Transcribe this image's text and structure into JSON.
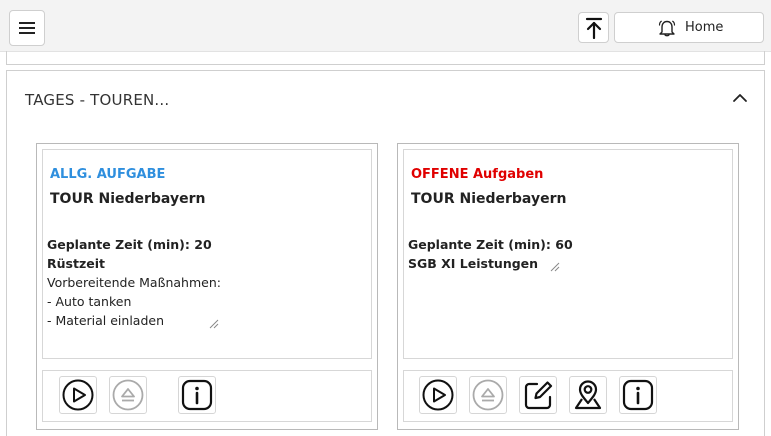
{
  "header": {
    "menu_icon": "hamburger-icon",
    "top_icon": "arrow-to-top-icon",
    "home_label": "Home",
    "home_icon": "bell-icon"
  },
  "section": {
    "title": "TAGES - TOUREN...",
    "toggle_icon": "chevron-up-icon"
  },
  "cards": [
    {
      "category": "ALLG. AUFGABE",
      "category_color": "#2f8fde",
      "tour": "TOUR Niederbayern",
      "planned_time": "Geplante Zeit (min): 20",
      "type": "Rüstzeit",
      "notes": [
        "Vorbereitende Maßnahmen:",
        "- Auto tanken",
        "- Material einladen"
      ],
      "actions": [
        "play-icon",
        "eject-icon",
        "info-icon"
      ]
    },
    {
      "category": "OFFENE Aufgaben",
      "category_color": "#e00000",
      "tour": "TOUR Niederbayern",
      "planned_time": "Geplante Zeit (min): 60",
      "type": "SGB XI Leistungen",
      "notes": [],
      "actions": [
        "play-icon",
        "eject-icon",
        "edit-icon",
        "map-pin-icon",
        "info-icon"
      ]
    }
  ]
}
